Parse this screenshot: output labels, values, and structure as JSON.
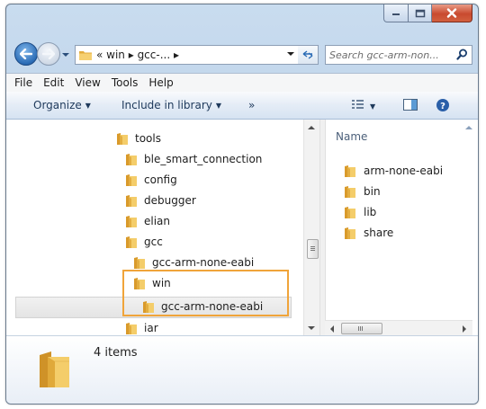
{
  "window": {
    "caption_buttons": {
      "minimize_icon": "minimize-icon",
      "maximize_icon": "maximize-icon",
      "close_icon": "close-icon"
    }
  },
  "nav": {
    "back_icon": "back-arrow-icon",
    "forward_icon": "forward-arrow-icon",
    "address_crumb": "« win ▸ gcc-... ▸",
    "refresh_icon": "refresh-icon",
    "search_placeholder": "Search gcc-arm-non..."
  },
  "menu": [
    "File",
    "Edit",
    "View",
    "Tools",
    "Help"
  ],
  "commands": {
    "organize": "Organize",
    "include": "Include in library",
    "more": "»"
  },
  "tree": [
    {
      "label": "tools"
    },
    {
      "label": "ble_smart_connection"
    },
    {
      "label": "config"
    },
    {
      "label": "debugger"
    },
    {
      "label": "elian"
    },
    {
      "label": "gcc"
    },
    {
      "label": "gcc-arm-none-eabi"
    },
    {
      "label": "win"
    },
    {
      "label": "gcc-arm-none-eabi"
    },
    {
      "label": "iar"
    }
  ],
  "list": {
    "column": "Name",
    "items": [
      {
        "label": "arm-none-eabi"
      },
      {
        "label": "bin"
      },
      {
        "label": "lib"
      },
      {
        "label": "share"
      }
    ]
  },
  "details": {
    "count": "4 items"
  },
  "colors": {
    "highlight_border": "#f0a43a",
    "folder": "#f2c35a",
    "accent": "#2b6cb6"
  }
}
